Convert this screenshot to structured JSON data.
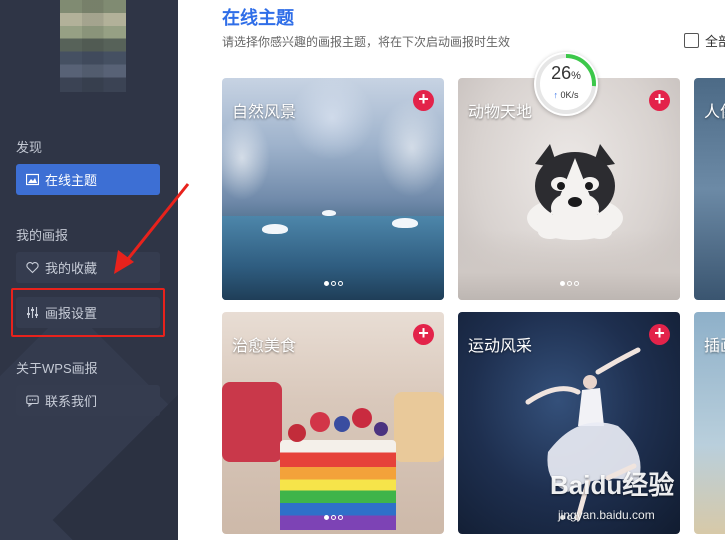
{
  "sidebar": {
    "discover_title": "发现",
    "online_theme": "在线主题",
    "my_pictorial_title": "我的画报",
    "favorites": "我的收藏",
    "settings": "画报设置",
    "about_title": "关于WPS画报",
    "contact": "联系我们"
  },
  "main": {
    "title": "在线主题",
    "subtitle": "请选择你感兴趣的画报主题，将在下次启动画报时生效",
    "select_all": "全部",
    "cards": [
      {
        "label": "自然风景"
      },
      {
        "label": "动物天地"
      },
      {
        "label": "人像"
      },
      {
        "label": "治愈美食"
      },
      {
        "label": "运动风采"
      },
      {
        "label": "插画"
      }
    ]
  },
  "gauge": {
    "percent": "26",
    "percent_sign": "%",
    "speed": "0K/s"
  },
  "watermark": {
    "brand": "Baidu经验",
    "url": "jingyan.baidu.com"
  },
  "colors": {
    "accent": "#3d6fd4",
    "add_button": "#e3234a",
    "highlight_box": "#e8221c",
    "sidebar_bg": "#2f3546"
  }
}
